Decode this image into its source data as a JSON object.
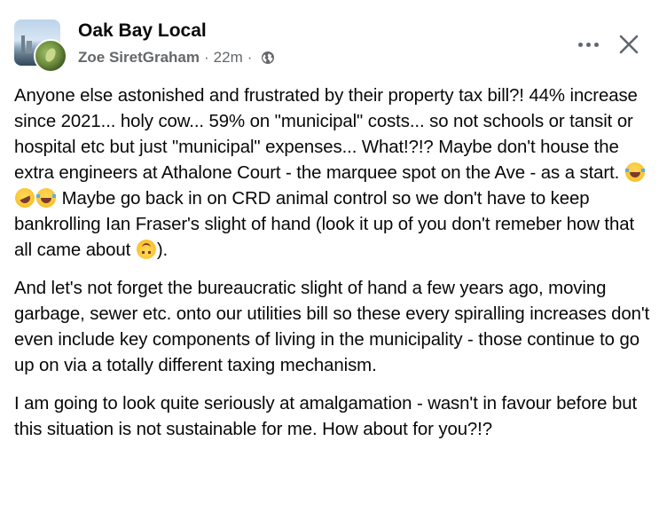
{
  "post": {
    "group_name": "Oak Bay Local",
    "author": "Zoe SiretGraham",
    "separator": "·",
    "time": "22m",
    "privacy_icon": "globe-icon"
  },
  "actions": {
    "more_icon": "more-horizontal-icon",
    "close_icon": "close-icon"
  },
  "content": {
    "p1_a": "Anyone else astonished and frustrated by their property tax bill?! 44% increase since 2021... holy cow... 59% on \"municipal\" costs... so not schools or tansit or hospital etc but just \"municipal\" expenses... What!?!? Maybe don't house the extra engineers at Athalone Court - the marquee spot on the Ave - as a start.",
    "p1_b": "Maybe go back in on CRD animal control so we don't have to keep bankrolling Ian Fraser's slight of hand (look it up of you don't remeber how that all came about",
    "p1_c": ").",
    "p2": "And let's not forget the bureaucratic slight of hand a few years ago, moving garbage, sewer etc. onto our utilities bill so these every spiralling increases don't even include key components of living in the municipality - those continue to go up on via a totally different taxing mechanism.",
    "p3": "I am going to look quite seriously at amalgamation - wasn't in favour before but this situation is not sustainable for me. How about for you?!?",
    "emojis": [
      "grinning-squinting-tears-emoji",
      "rolling-on-floor-laughing-emoji",
      "grinning-squinting-tears-emoji",
      "upside-down-face-emoji"
    ]
  },
  "colors": {
    "text": "#080809",
    "secondary_text": "#65676b",
    "icon": "#606770"
  }
}
